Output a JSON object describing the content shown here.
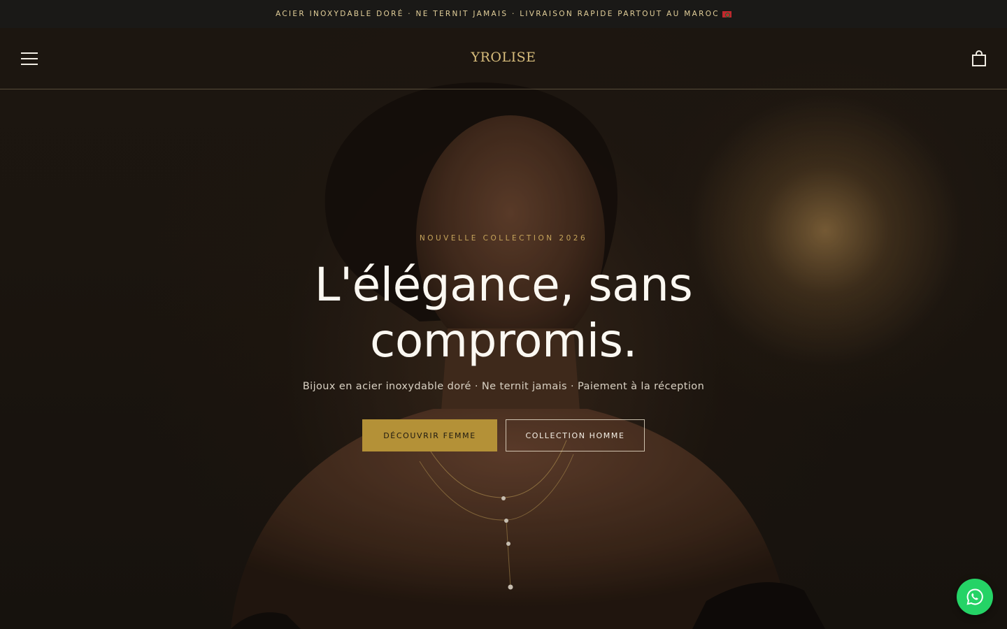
{
  "announcement": {
    "text": "ACIER INOXYDABLE DORÉ · NE TERNIT JAMAIS · LIVRAISON RAPIDE PARTOUT AU MAROC",
    "flag_icon": "morocco-flag-icon"
  },
  "header": {
    "logo": "YROLISE",
    "menu_icon": "hamburger-menu-icon",
    "cart_icon": "shopping-bag-icon"
  },
  "hero": {
    "eyebrow": "NOUVELLE COLLECTION 2026",
    "headline": "L'élégance, sans compromis.",
    "subheadline": "Bijoux en acier inoxydable doré · Ne ternit jamais · Paiement à la réception",
    "primary_cta": "DÉCOUVRIR FEMME",
    "secondary_cta": "COLLECTION HOMME"
  },
  "floating": {
    "whatsapp_icon": "whatsapp-icon"
  },
  "colors": {
    "announcement_bg": "#1a1917",
    "announcement_text": "#e2cf9a",
    "accent_gold": "#b49137",
    "eyebrow_gold": "#c7a55b",
    "logo_gold": "#d8bd7c",
    "whatsapp_green": "#25d366",
    "hero_text": "#fbf8f2"
  }
}
